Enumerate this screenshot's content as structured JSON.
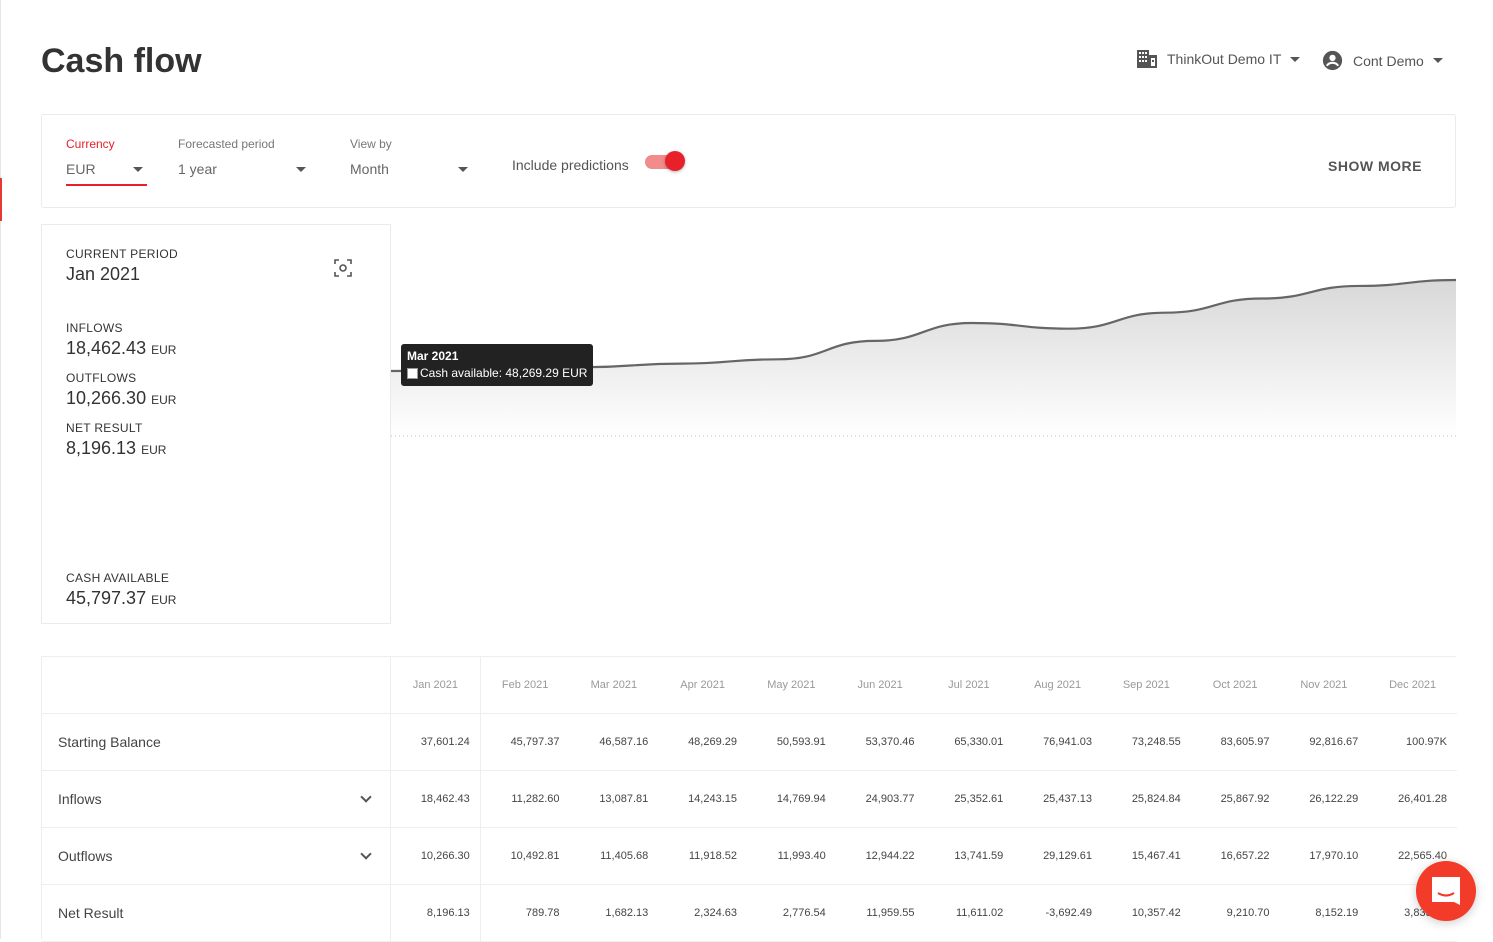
{
  "page": {
    "title": "Cash flow"
  },
  "header": {
    "company": "ThinkOut Demo IT",
    "user": "Cont Demo",
    "accent": "#e8202a"
  },
  "filters": {
    "currency": {
      "label": "Currency",
      "value": "EUR"
    },
    "period": {
      "label": "Forecasted period",
      "value": "1 year"
    },
    "view": {
      "label": "View by",
      "value": "Month"
    },
    "predictions": {
      "label": "Include predictions",
      "on": true
    },
    "show_more": "SHOW MORE"
  },
  "summary": {
    "period_label": "CURRENT PERIOD",
    "period": "Jan 2021",
    "inflows_label": "INFLOWS",
    "inflows": "18,462.43",
    "outflows_label": "OUTFLOWS",
    "outflows": "10,266.30",
    "net_label": "NET RESULT",
    "net": "8,196.13",
    "cash_label": "CASH AVAILABLE",
    "cash": "45,797.37",
    "unit": "EUR"
  },
  "chart_data": {
    "type": "area",
    "x": [
      "Jan 2021",
      "Feb 2021",
      "Mar 2021",
      "Apr 2021",
      "May 2021",
      "Jun 2021",
      "Jul 2021",
      "Aug 2021",
      "Sep 2021",
      "Oct 2021",
      "Nov 2021",
      "Dec 2021"
    ],
    "series": [
      {
        "name": "Cash available",
        "values": [
          45797.37,
          46587.16,
          48269.29,
          50593.91,
          53370.46,
          65330.01,
          76941.03,
          73248.55,
          83605.97,
          92816.67,
          100968.86,
          104804.74
        ]
      }
    ],
    "tooltip": {
      "title": "Mar 2021",
      "text": "Cash available: 48,269.29 EUR"
    }
  },
  "table": {
    "months": [
      "Jan 2021",
      "Feb 2021",
      "Mar 2021",
      "Apr 2021",
      "May 2021",
      "Jun 2021",
      "Jul 2021",
      "Aug 2021",
      "Sep 2021",
      "Oct 2021",
      "Nov 2021",
      "Dec 2021"
    ],
    "rows": [
      {
        "label": "Starting Balance",
        "values": [
          "37,601.24",
          "45,797.37",
          "46,587.16",
          "48,269.29",
          "50,593.91",
          "53,370.46",
          "65,330.01",
          "76,941.03",
          "73,248.55",
          "83,605.97",
          "92,816.67",
          "100.97K"
        ]
      },
      {
        "label": "Inflows",
        "values": [
          "18,462.43",
          "11,282.60",
          "13,087.81",
          "14,243.15",
          "14,769.94",
          "24,903.77",
          "25,352.61",
          "25,437.13",
          "25,824.84",
          "25,867.92",
          "26,122.29",
          "26,401.28"
        ]
      },
      {
        "label": "Outflows",
        "values": [
          "10,266.30",
          "10,492.81",
          "11,405.68",
          "11,918.52",
          "11,993.40",
          "12,944.22",
          "13,741.59",
          "29,129.61",
          "15,467.41",
          "16,657.22",
          "17,970.10",
          "22,565.40"
        ]
      },
      {
        "label": "Net Result",
        "values": [
          "8,196.13",
          "789.78",
          "1,682.13",
          "2,324.63",
          "2,776.54",
          "11,959.55",
          "11,611.02",
          "-3,692.49",
          "10,357.42",
          "9,210.70",
          "8,152.19",
          "3,835.88"
        ]
      }
    ]
  }
}
